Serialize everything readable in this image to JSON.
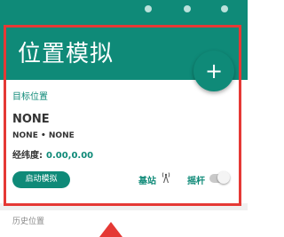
{
  "header": {
    "title": "位置模拟",
    "add_icon": "plus-icon",
    "accent_color": "#0f8a78"
  },
  "target": {
    "section_label": "目标位置",
    "place_name": "NONE",
    "place_sub": "NONE • NONE",
    "coords_label": "经纬度:",
    "coords_value": "0.00,0.00"
  },
  "controls": {
    "start_label": "启动模拟",
    "base_station_label": "基站",
    "base_station_icon": "antenna-icon",
    "joystick_label": "摇杆",
    "joystick_toggle": false
  },
  "history": {
    "label": "历史位置"
  },
  "annotation": {
    "highlight_color": "#e53935",
    "arrow_icon": "up-arrow-icon"
  }
}
